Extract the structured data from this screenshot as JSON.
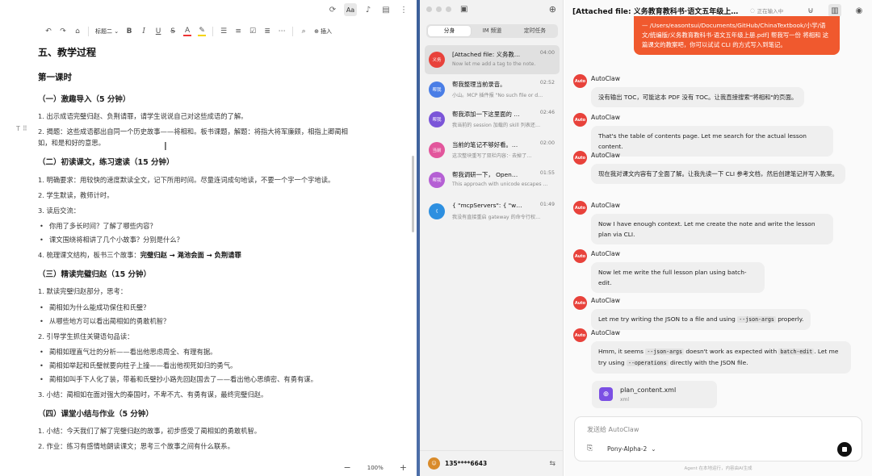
{
  "editor": {
    "top_icons": [
      "refresh-icon",
      "font-size-icon",
      "microphone-icon",
      "export-icon",
      "more-icon"
    ],
    "font_button_label": "Aa",
    "heading_select": "标题二",
    "insert_label": "插入",
    "lines": [
      {
        "cls": "h1",
        "text": "五、教学过程"
      },
      {
        "cls": "h2",
        "text": "第一课时"
      },
      {
        "cls": "h3",
        "text": "（一）激趣导入（5 分钟）"
      },
      {
        "cls": "p",
        "text": "1. 出示成语完璧归赵、负荆请罪，请学生说说自己对这些成语的了解。"
      },
      {
        "cls": "p",
        "text": "2. 揭题：这些成语都出自同一个历史故事——将相和。板书课题，解题：将指大将军廉颇，相指上卿蔺相"
      },
      {
        "cls": "p",
        "text": "如，和是和好的意思。"
      },
      {
        "cls": "h3",
        "text": "（二）初读课文，练习速读（15 分钟）"
      },
      {
        "cls": "p",
        "text": "1. 明确要求：用较快的速度默读全文，记下所用时间。尽量连词成句地读，不要一个字一个字地读。"
      },
      {
        "cls": "p",
        "text": "2. 学生默读，教师计时。"
      },
      {
        "cls": "p",
        "text": "3. 读后交流："
      },
      {
        "cls": "bul",
        "text": "你用了多长时间？了解了哪些内容？"
      },
      {
        "cls": "bul",
        "text": "课文围绕将相讲了几个小故事？分别是什么？"
      },
      {
        "cls": "p",
        "text": "4. 梳理课文结构，板书三个故事：",
        "bold": "完璧归赵 → 渑池会面 → 负荆请罪"
      },
      {
        "cls": "h3",
        "text": "（三）精读完璧归赵（15 分钟）"
      },
      {
        "cls": "p",
        "text": "1. 默读完璧归赵部分，思考："
      },
      {
        "cls": "bul",
        "text": "蔺相如为什么能成功保住和氏璧？"
      },
      {
        "cls": "bul",
        "text": "从哪些地方可以看出蔺相如的勇敢机智？"
      },
      {
        "cls": "p",
        "text": "2. 引导学生抓住关键语句品读："
      },
      {
        "cls": "bul",
        "text": "蔺相如理直气壮的分析——看出他思虑周全、有理有据。"
      },
      {
        "cls": "bul",
        "text": "蔺相如举起和氏璧就要向柱子上撞——看出他视死如归的勇气。"
      },
      {
        "cls": "bul",
        "text": "蔺相如叫手下人化了装，带着和氏璧抄小路先回赵国去了——看出他心思缜密、有勇有谋。"
      },
      {
        "cls": "p",
        "text": "3. 小结：蔺相如在面对强大的秦国时，不卑不亢、有勇有谋，最终完璧归赵。"
      },
      {
        "cls": "h3",
        "text": "（四）课堂小结与作业（5 分钟）"
      },
      {
        "cls": "p",
        "text": "1. 小结：今天我们了解了完璧归赵的故事，初步感受了蔺相如的勇敢机智。"
      },
      {
        "cls": "p",
        "text": "2. 作业：练习有感情地朗读课文；思考三个故事之间有什么联系。"
      }
    ],
    "zoom": "100%"
  },
  "sessions": {
    "tabs": [
      "分身",
      "IM 频道",
      "定时任务"
    ],
    "active_tab": 0,
    "items": [
      {
        "avatar": "义务",
        "color": "#e8423b",
        "title": "[Attached file: 义务教育…",
        "time": "04:00",
        "preview": "Now let me add a tag to the note.",
        "selected": true
      },
      {
        "avatar": "帮我",
        "color": "#4a7ee6",
        "title": "帮我整理当前录音。",
        "time": "02:52",
        "preview": "小山。MCP 插件报 \"No such file or d…",
        "selected": false
      },
      {
        "avatar": "帮我",
        "color": "#7b55d8",
        "title": "帮我添加一下这里面的 …",
        "time": "02:46",
        "preview": "我当前的 session 加载的 skill 列表还…",
        "selected": false
      },
      {
        "avatar": "当前",
        "color": "#e2569c",
        "title": "当前的笔记不够好看。…",
        "time": "02:00",
        "preview": "这次整块重写了双栏内容：· 去掉了…",
        "selected": false
      },
      {
        "avatar": "帮我",
        "color": "#b560d4",
        "title": "帮我调研一下， Open…",
        "time": "01:55",
        "preview": "This approach with unicode escapes …",
        "selected": false
      },
      {
        "avatar": "{",
        "color": "#2d8fe0",
        "title": "{ \"mcpServers\": { \"wp…",
        "time": "01:49",
        "preview": "我没有直接重启 gateway 的命令行权…",
        "selected": false
      }
    ],
    "account": "135****6643"
  },
  "chat": {
    "title": "[Attached file: 义务教育教科书·语文五年级上册.pdf]",
    "status": "正在输入中",
    "user_bubble": "— /Users/easontsui/Documents/GitHub/ChinaTextbook/小学/语文/统编版/义务教育教科书·语文五年级上册.pdf] 帮我写一份 将相和 这篇课文的教案吧，你可以试试 CLI 的方式写入到笔记。",
    "sender": "AutoClaw",
    "avatar_label": "Auto",
    "messages": [
      {
        "text": "没有输出 TOC，可能这本 PDF 没有 TOC。让我直接搜索\"将相和\"的页面。"
      },
      {
        "text": "That's the table of contents page. Let me search for the actual lesson content."
      },
      {
        "text": "现在我对课文内容有了全面了解。让我先读一下 CLI 参考文档，然后创建笔记并写入教案。"
      },
      {
        "text": "Now I have enough context. Let me create the note and write the lesson plan via CLI."
      },
      {
        "text": "Now let me write the full lesson plan using batch-edit."
      },
      {
        "text_a": "Let me try writing the JSON to a file and using ",
        "code_a": "--json-args",
        "text_b": " properly."
      },
      {
        "text_a": "Hmm, it seems ",
        "code_a": "--json-args",
        "text_b": " doesn't work as expected with ",
        "code_b": "batch-edit",
        "text_c": ". Let me try using ",
        "code_c": "--operations",
        "text_d": " directly with the JSON file."
      }
    ],
    "file": {
      "name": "plan_content.xml",
      "type": "xml"
    },
    "composer_placeholder": "发送给 AutoClaw",
    "model": "Pony-Alpha-2",
    "footnote": "Agent 在本地运行，内容由AI生成"
  }
}
